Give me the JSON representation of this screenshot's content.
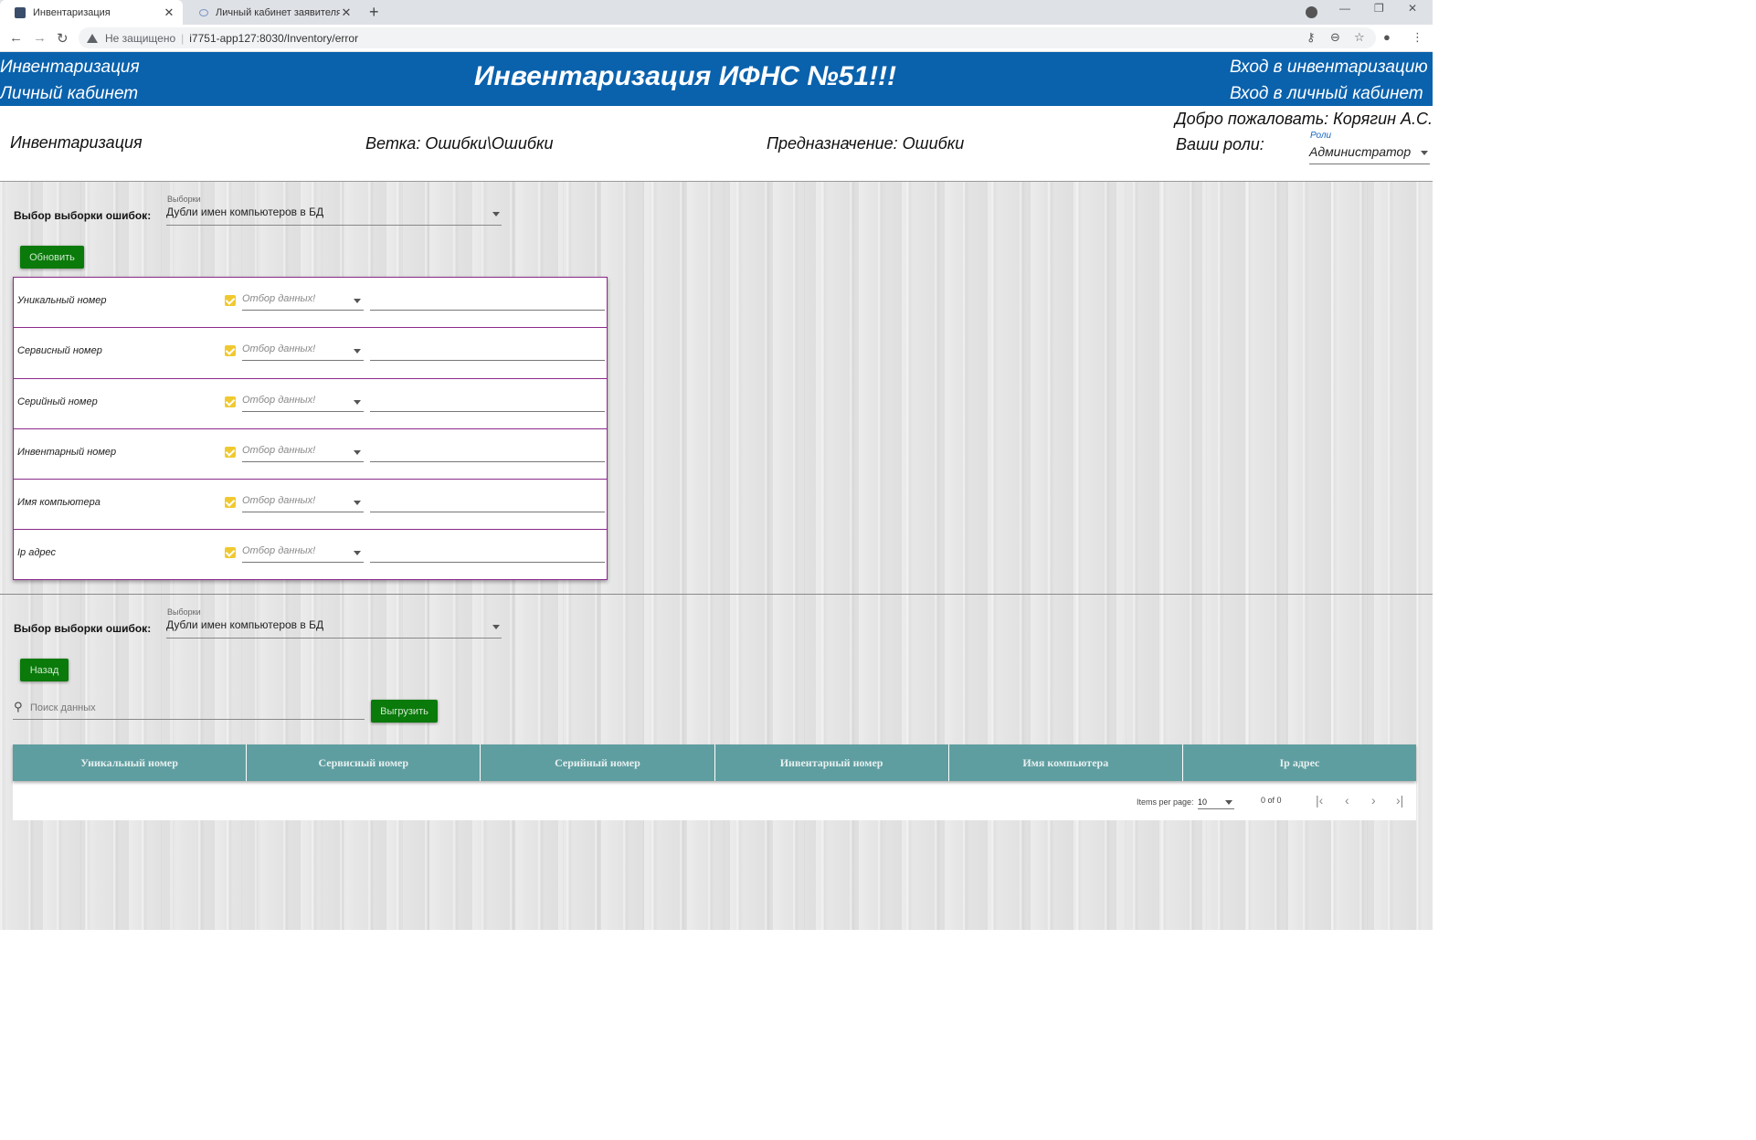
{
  "browser": {
    "tabs": [
      {
        "label": "Инвентаризация"
      },
      {
        "label": "Личный кабинет заявителя"
      }
    ],
    "security_label": "Не защищено",
    "url": "i7751-app127:8030/Inventory/error"
  },
  "header": {
    "nav_inventory": "Инвентаризация",
    "nav_cabinet": "Личный кабинет",
    "title": "Инвентаризация ИФНС №51!!!",
    "login_inventory": "Вход в инвентаризацию",
    "login_cabinet": "Вход в личный кабинет"
  },
  "info": {
    "section": "Инвентаризация",
    "branch": "Ветка: Ошибки\\Ошибки",
    "purpose": "Предназначение: Ошибки",
    "welcome": "Добро пожаловать: Корягин А.С.",
    "roles_label": "Ваши роли:",
    "roles_caption": "Роли",
    "roles_value": "Администратор"
  },
  "top_panel": {
    "select_label": "Выбор выборки ошибок:",
    "select_caption": "Выборки",
    "select_value": "Дубли имен компьютеров в БД",
    "refresh_button": "Обновить",
    "filters": [
      {
        "label": "Уникальный номер",
        "placeholder": "Отбор данных!"
      },
      {
        "label": "Сервисный номер",
        "placeholder": "Отбор данных!"
      },
      {
        "label": "Серийный номер",
        "placeholder": "Отбор данных!"
      },
      {
        "label": "Инвентарный номер",
        "placeholder": "Отбор данных!"
      },
      {
        "label": "Имя компьютера",
        "placeholder": "Отбор данных!"
      },
      {
        "label": "Ip адрес",
        "placeholder": "Отбор данных!"
      }
    ]
  },
  "bottom_panel": {
    "select_label": "Выбор выборки ошибок:",
    "select_caption": "Выборки",
    "select_value": "Дубли имен компьютеров в БД",
    "back_button": "Назад",
    "search_placeholder": "Поиск данных",
    "export_button": "Выгрузить",
    "columns": [
      "Уникальный номер",
      "Сервисный номер",
      "Серийный номер",
      "Инвентарный номер",
      "Имя компьютера",
      "Ip адрес"
    ],
    "paginator": {
      "items_per_page_label": "Items per page:",
      "page_size": "10",
      "range": "0 of 0"
    }
  },
  "colors": {
    "header_blue": "#0a62ad",
    "button_green": "#0a7a0a",
    "grid_header_teal": "#5f9ea0",
    "filter_border_purple": "#8a2a8a",
    "checkbox_yellow": "#f0c930"
  }
}
